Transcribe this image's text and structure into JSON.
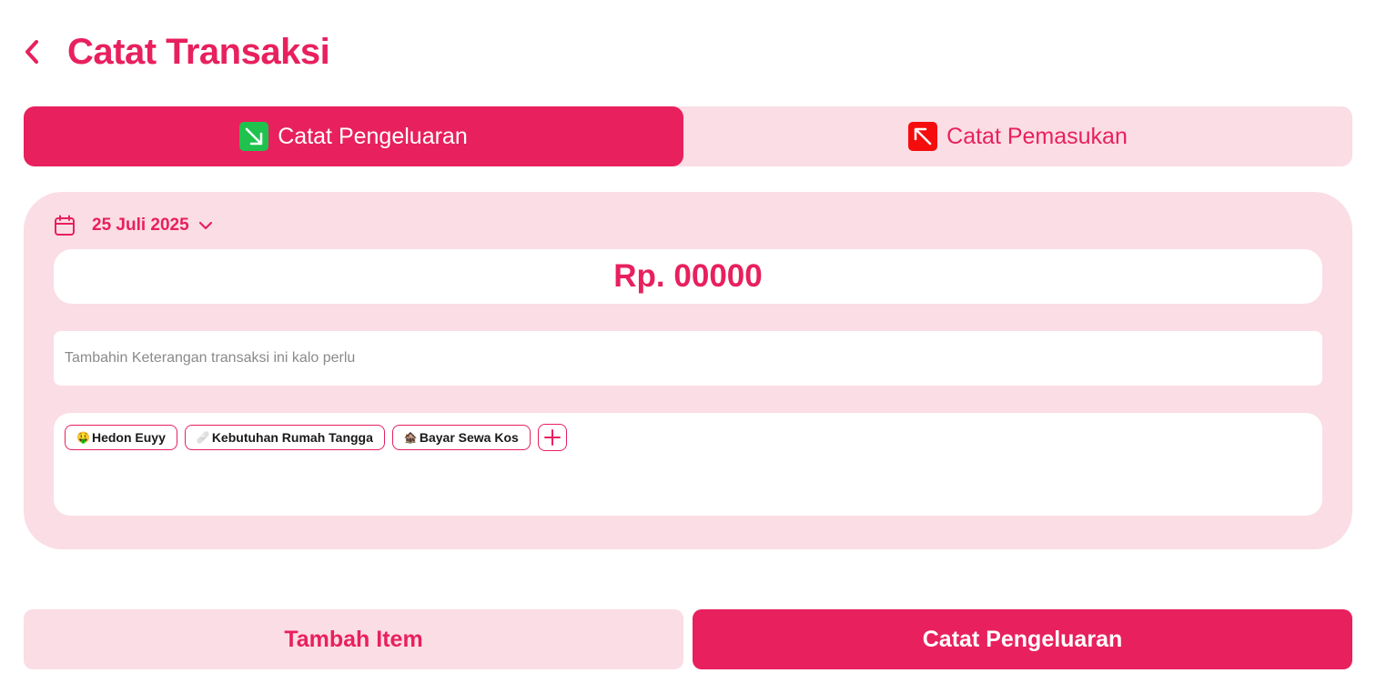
{
  "header": {
    "title": "Catat Transaksi",
    "back_icon": "chevron-left-icon"
  },
  "tabs": [
    {
      "label": "Catat Pengeluaran",
      "active": true,
      "icon": "arrow-down-right-icon",
      "icon_color": "#1fc24d"
    },
    {
      "label": "Catat Pemasukan",
      "active": false,
      "icon": "arrow-up-left-icon",
      "icon_color": "#f50d0d"
    }
  ],
  "form": {
    "date": "25 Juli 2025",
    "amount": "Rp. 00000",
    "note_placeholder": "Tambahin Keterangan transaksi ini kalo perlu",
    "note_value": "",
    "tags": [
      {
        "emoji": "🤑",
        "label": "Hedon Euyy"
      },
      {
        "emoji": "🩹",
        "label": "Kebutuhan Rumah Tangga"
      },
      {
        "emoji": "🏚️",
        "label": "Bayar Sewa Kos"
      }
    ]
  },
  "actions": {
    "secondary_label": "Tambah Item",
    "primary_label": "Catat Pengeluaran"
  },
  "colors": {
    "accent": "#e8205e",
    "surface": "#fbdde5",
    "background": "#ffffff"
  }
}
